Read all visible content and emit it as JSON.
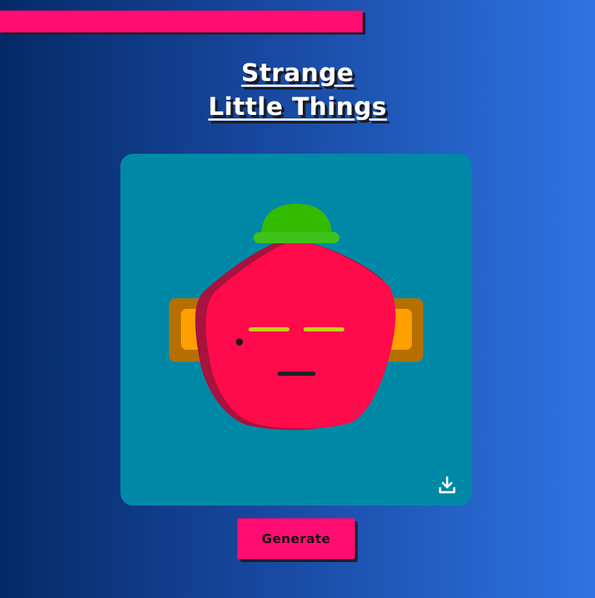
{
  "progress": {
    "value": 0.61
  },
  "title": {
    "line1": "Strange",
    "line2": "Little Things"
  },
  "creature": {
    "background_color": "#0089a7",
    "hat_color": "#33bb00",
    "body_color": "#ff0a4a",
    "body_shadow_color": "#a8123e",
    "ear_outer_color": "#b56f00",
    "ear_inner_color": "#ffa000",
    "eye_color": "#c9cf1a"
  },
  "download": {
    "icon": "download-icon"
  },
  "actions": {
    "generate_label": "Generate"
  },
  "colors": {
    "accent": "#ff0d72",
    "gradient_start": "#042a66",
    "gradient_end": "#2d74e2"
  }
}
